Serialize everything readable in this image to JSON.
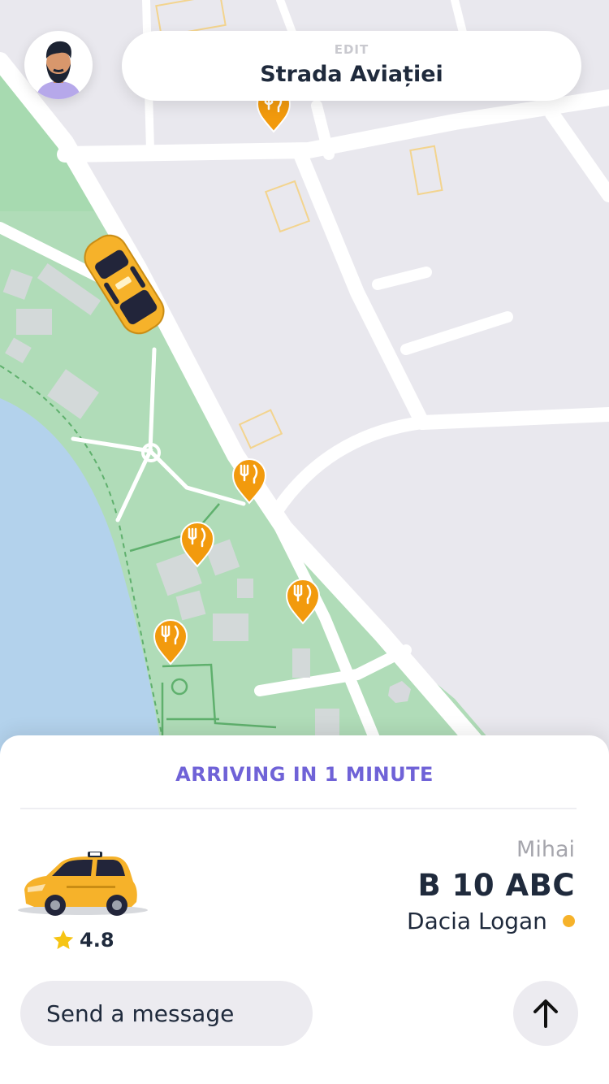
{
  "header": {
    "edit_label": "EDIT",
    "address": "Strada Aviației"
  },
  "map": {
    "pin_icon": "restaurant-pin-icon",
    "vehicle_icon": "taxi-car-icon",
    "colors": {
      "land": "#e9e8ee",
      "park": "#a6d9ae",
      "water": "#b3d2ec",
      "road": "#ffffff",
      "pin": "#f29a0d"
    }
  },
  "ride": {
    "status": "ARRIVING IN 1 MINUTE",
    "rating": "4.8",
    "driver_name": "Mihai",
    "plate": "B 10 ABC",
    "car_model": "Dacia Logan"
  },
  "message": {
    "placeholder": "Send a message"
  },
  "icons": {
    "avatar": "avatar",
    "star": "star-icon",
    "send": "arrow-up-icon"
  },
  "colors": {
    "accent": "#6f62d7",
    "text": "#1f2a3c",
    "muted": "#a6a6ad",
    "taxi_yellow": "#f6b22a",
    "status_dot": "#f6b22a"
  }
}
